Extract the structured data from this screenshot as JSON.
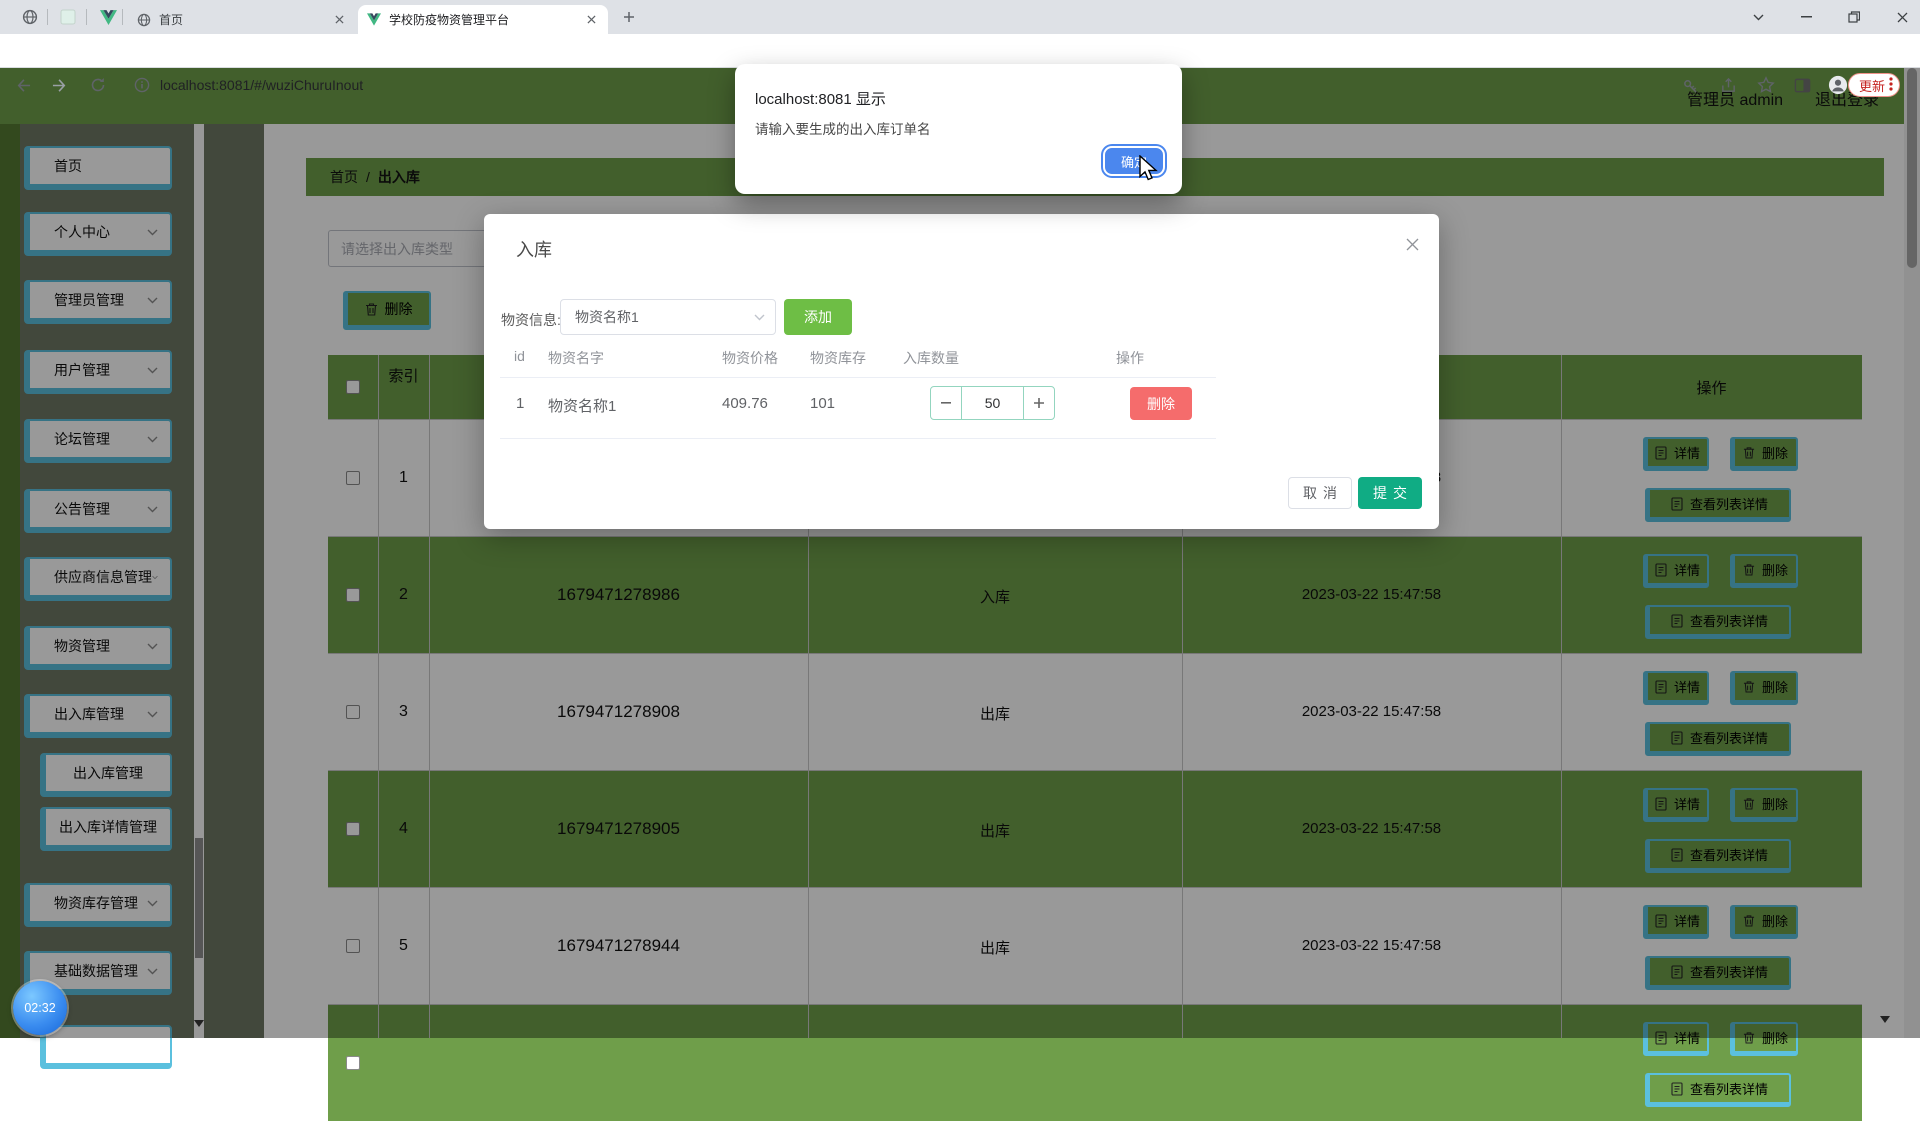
{
  "browser": {
    "pinned_tabs": [
      "globe",
      "blank-page",
      "vue"
    ],
    "tabs": [
      {
        "icon": "globe",
        "title": "首页",
        "active": false
      },
      {
        "icon": "vue",
        "title": "学校防疫物资管理平台",
        "active": true
      }
    ],
    "address": {
      "url": "localhost:8081/#/wuziChuruInout",
      "update_label": "更新"
    }
  },
  "js_dialog": {
    "title": "localhost:8081 显示",
    "message": "请输入要生成的出入库订单名",
    "confirm_label": "确定"
  },
  "app_header": {
    "user": "管理员 admin",
    "logout": "退出登录"
  },
  "sidebar": {
    "items": [
      {
        "label": "首页",
        "chevron": false,
        "sub": false
      },
      {
        "label": "个人中心",
        "chevron": true,
        "sub": false
      },
      {
        "label": "管理员管理",
        "chevron": true,
        "sub": false
      },
      {
        "label": "用户管理",
        "chevron": true,
        "sub": false
      },
      {
        "label": "论坛管理",
        "chevron": true,
        "sub": false
      },
      {
        "label": "公告管理",
        "chevron": true,
        "sub": false
      },
      {
        "label": "供应商信息管理",
        "chevron": true,
        "sub": false
      },
      {
        "label": "物资管理",
        "chevron": true,
        "sub": false
      },
      {
        "label": "出入库管理",
        "chevron": true,
        "sub": false
      },
      {
        "label": "出入库管理",
        "chevron": false,
        "sub": true
      },
      {
        "label": "出入库详情管理",
        "chevron": false,
        "sub": true
      },
      {
        "label": "物资库存管理",
        "chevron": true,
        "sub": false
      },
      {
        "label": "基础数据管理",
        "chevron": true,
        "sub": false
      },
      {
        "label": "",
        "chevron": false,
        "sub": true
      }
    ]
  },
  "breadcrumb": {
    "home": "首页",
    "separator": "/",
    "current": "出入库"
  },
  "toolbar": {
    "filter_placeholder": "请选择出入库类型",
    "delete_label": "删除"
  },
  "main_table": {
    "headers": {
      "index": "索引",
      "actions": "操作"
    },
    "action_labels": {
      "detail": "详情",
      "delete": "删除",
      "view_list": "查看列表详情"
    },
    "rows": [
      {
        "index": "1",
        "number": "",
        "type": "",
        "time": "2023-03-22 15:47:58"
      },
      {
        "index": "2",
        "number": "1679471278986",
        "type": "入库",
        "time": "2023-03-22 15:47:58"
      },
      {
        "index": "3",
        "number": "1679471278908",
        "type": "出库",
        "time": "2023-03-22 15:47:58"
      },
      {
        "index": "4",
        "number": "1679471278905",
        "type": "出库",
        "time": "2023-03-22 15:47:58"
      },
      {
        "index": "5",
        "number": "1679471278944",
        "type": "出库",
        "time": "2023-03-22 15:47:58"
      },
      {
        "index": "",
        "number": "",
        "type": "",
        "time": ""
      }
    ]
  },
  "modal": {
    "title": "入库",
    "form": {
      "label": "物资信息:",
      "selected": "物资名称1",
      "add_label": "添加"
    },
    "table": {
      "headers": {
        "id": "id",
        "name": "物资名字",
        "price": "物资价格",
        "stock": "物资库存",
        "qty": "入库数量",
        "action": "操作"
      },
      "rows": [
        {
          "id": "1",
          "name": "物资名称1",
          "price": "409.76",
          "stock": "101",
          "qty": "50",
          "action": "删除"
        }
      ]
    },
    "footer": {
      "cancel": "取消",
      "submit": "提交"
    }
  },
  "timer": "02:32",
  "colors": {
    "theme_green": "#6f9e4a",
    "sidebar_green": "#567a33",
    "teal_border": "#5bc0de",
    "add_green": "#6ebe45",
    "danger_red": "#f56c6c",
    "submit_teal": "#10ac84",
    "dialog_blue": "#4b87ee",
    "update_red": "#c5221f"
  }
}
